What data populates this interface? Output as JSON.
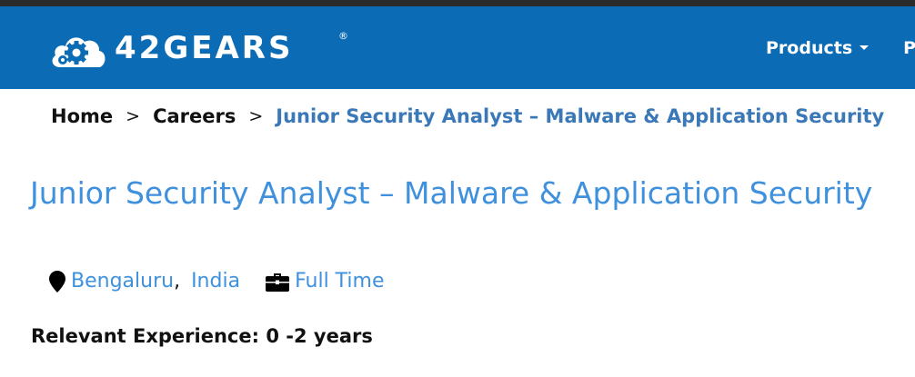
{
  "header": {
    "brand_name": "42GEARS",
    "brand_mark": "®",
    "logo_icon": "cloud-gear-logo-icon",
    "background_color": "#0b6cb5",
    "nav": [
      {
        "label": "Products",
        "icon": "chevron-down-icon"
      },
      {
        "label": "P"
      }
    ]
  },
  "breadcrumb": {
    "home": "Home",
    "careers": "Careers",
    "separator": ">",
    "current": "Junior Security Analyst – Malware & Application Security"
  },
  "job": {
    "title": "Junior Security Analyst – Malware & Application Security",
    "city": "Bengaluru",
    "comma": ",",
    "country": "India",
    "location_icon": "map-pin-icon",
    "type": "Full Time",
    "type_icon": "briefcase-icon",
    "experience": "Relevant Experience: 0 -2 years"
  },
  "colors": {
    "link": "#3f91dd",
    "breadcrumb_current": "#3a78b8",
    "text": "#111111"
  }
}
